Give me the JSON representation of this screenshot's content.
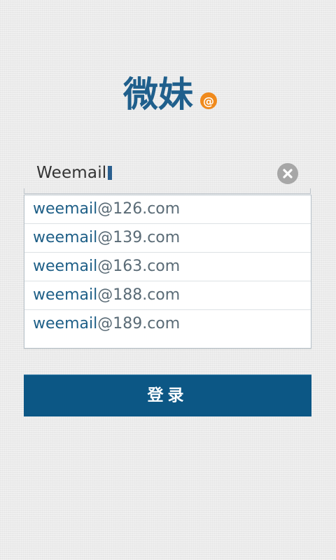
{
  "logo": {
    "text": "微妹",
    "mark": "@",
    "colors": {
      "text": "#1f5f8c",
      "mark": "#f08a1c"
    }
  },
  "email_input": {
    "value": "Weemail",
    "clear_icon": "clear-circle-icon"
  },
  "suggestions": [
    {
      "local": "weemail",
      "domain": "@126.com"
    },
    {
      "local": "weemail",
      "domain": "@139.com"
    },
    {
      "local": "weemail",
      "domain": "@163.com"
    },
    {
      "local": "weemail",
      "domain": "@188.com"
    },
    {
      "local": "weemail",
      "domain": "@189.com"
    }
  ],
  "login_button": {
    "label": "登录"
  },
  "colors": {
    "accent": "#0c5785",
    "suggestion_text": "#1e5f87",
    "background": "#ebebeb"
  }
}
